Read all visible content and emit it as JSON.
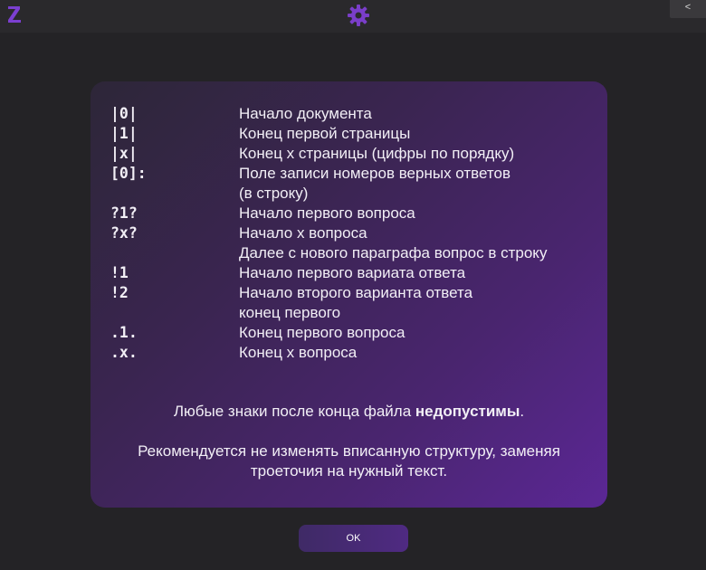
{
  "header": {
    "logo_icon": "z-logo-icon",
    "settings_icon": "gear-icon",
    "collapse_label": "<"
  },
  "accent_color": "#6a33b8",
  "legend": [
    {
      "code": "|0|",
      "desc": "Начало документа"
    },
    {
      "code": "|1|",
      "desc": "Конец первой страницы"
    },
    {
      "code": "|x|",
      "desc": "Конец x страницы (цифры по порядку)"
    },
    {
      "code": "[0]:",
      "desc": "Поле записи номеров верных ответов"
    },
    {
      "code": "",
      "desc": "(в строку)"
    },
    {
      "code": "?1?",
      "desc": "Начало первого вопроса"
    },
    {
      "code": "?x?",
      "desc": "Начало x вопроса"
    },
    {
      "code": "",
      "desc": "Далее с нового параграфа вопрос в строку"
    },
    {
      "code": "!1",
      "desc": "Начало первого вариата ответа"
    },
    {
      "code": "!2",
      "desc": "Начало второго варианта ответа"
    },
    {
      "code": "",
      "desc": "конец первого"
    },
    {
      "code": ".1.",
      "desc": "Конец первого вопроса"
    },
    {
      "code": ".x.",
      "desc": "Конец x вопроса"
    }
  ],
  "notes": {
    "note1_prefix": "Любые знаки после конца файла ",
    "note1_bold": "недопустимы",
    "note1_suffix": ".",
    "note2_line1": "Рекомендуется не изменять вписанную структуру, заменяя",
    "note2_line2": "троеточия на нужный текст."
  },
  "ok_label": "OK"
}
